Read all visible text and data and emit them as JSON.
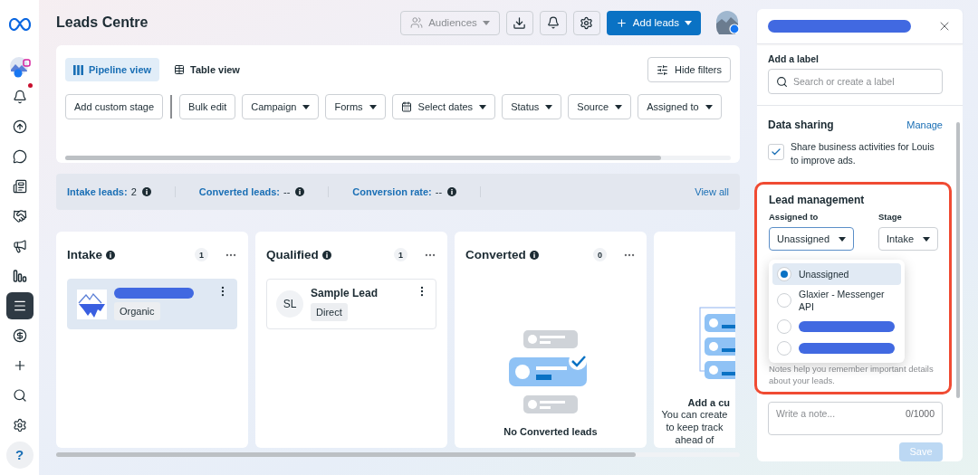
{
  "nav": {
    "items": [
      {
        "kind": "account",
        "selected": false
      },
      {
        "kind": "bell",
        "selected": false,
        "badge": true
      },
      {
        "kind": "automation",
        "selected": false
      },
      {
        "kind": "chat",
        "selected": false
      },
      {
        "kind": "pages",
        "selected": false
      },
      {
        "kind": "partners",
        "selected": false
      },
      {
        "kind": "ads",
        "selected": false
      },
      {
        "kind": "insights",
        "selected": false
      },
      {
        "kind": "menu",
        "selected": true
      },
      {
        "kind": "billing",
        "selected": false
      },
      {
        "kind": "create",
        "selected": false
      },
      {
        "kind": "search",
        "selected": false
      },
      {
        "kind": "settings",
        "selected": false
      },
      {
        "kind": "help",
        "label": "?",
        "selected": false
      }
    ]
  },
  "header": {
    "title": "Leads Centre",
    "audiences": {
      "label": "Audiences",
      "disabled": true
    },
    "add_leads": "Add leads"
  },
  "filters": {
    "views": [
      {
        "label": "Pipeline view",
        "selected": true
      },
      {
        "label": "Table view",
        "selected": false
      }
    ],
    "hide_filters": "Hide filters",
    "actions": [
      "Add custom stage",
      "Bulk edit"
    ],
    "dropdowns": [
      {
        "kind": "plain",
        "label": "Campaign"
      },
      {
        "kind": "plain",
        "label": "Forms"
      },
      {
        "kind": "date",
        "label": "Select dates"
      },
      {
        "kind": "plain",
        "label": "Status"
      },
      {
        "kind": "plain",
        "label": "Source"
      },
      {
        "kind": "plain",
        "label": "Assigned to"
      }
    ]
  },
  "stats": {
    "items": [
      {
        "label": "Intake leads:",
        "value": "2"
      },
      {
        "label": "Converted leads:",
        "value": "--"
      },
      {
        "label": "Conversion rate:",
        "value": "--"
      }
    ],
    "view_all": "View all"
  },
  "columns": [
    {
      "title": "Intake",
      "count": "1",
      "leads": [
        {
          "kind": "redacted",
          "source": "Organic",
          "selected": true
        }
      ]
    },
    {
      "title": "Qualified",
      "count": "1",
      "leads": [
        {
          "kind": "named",
          "name": "Sample Lead",
          "initials": "SL",
          "source": "Direct",
          "selected": false
        }
      ]
    },
    {
      "title": "Converted",
      "count": "0",
      "empty_text": "No Converted leads"
    }
  ],
  "custom_stage": {
    "title": "Add a cu",
    "lines": [
      "You can create",
      "to keep track",
      "ahead of"
    ]
  },
  "panel": {
    "add_label": {
      "title": "Add a label",
      "placeholder": "Search or create a label"
    },
    "data_sharing": {
      "title": "Data sharing",
      "link": "Manage",
      "checkbox": {
        "label": "Share business activities for Louis to improve ads.",
        "checked": true
      }
    },
    "lead_management": {
      "title": "Lead management",
      "assigned_label": "Assigned to",
      "assigned_value": "Unassigned",
      "stage_label": "Stage",
      "stage_value": "Intake",
      "options": [
        {
          "kind": "named",
          "label": "Unassigned",
          "selected": true
        },
        {
          "kind": "named",
          "label": "Glaxier - Messenger API",
          "selected": false
        },
        {
          "kind": "redacted",
          "selected": false
        },
        {
          "kind": "redacted",
          "selected": false
        }
      ],
      "hint": "Notes help you remember important details about your leads."
    },
    "notes": {
      "placeholder": "Write a note...",
      "counter": "0/1000"
    },
    "save": {
      "label": "Save",
      "disabled": true
    }
  }
}
